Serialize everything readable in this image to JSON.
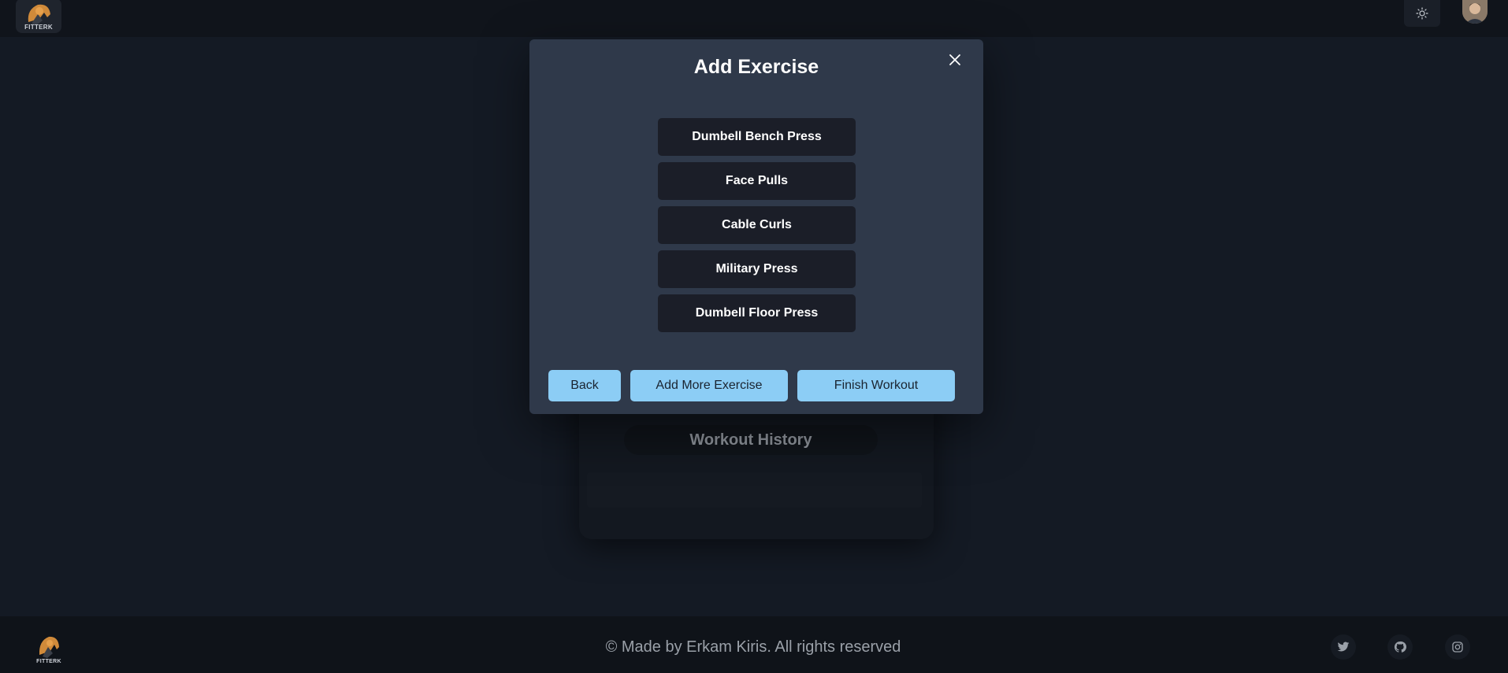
{
  "header": {
    "logo_text": "FITTERK",
    "theme_icon": "sun-icon"
  },
  "background": {
    "history_label": "Workout History"
  },
  "modal": {
    "title": "Add Exercise",
    "close_icon": "close-icon",
    "exercises": [
      "Dumbell Bench Press",
      "Face Pulls",
      "Cable Curls",
      "Military Press",
      "Dumbell Floor Press"
    ],
    "back_label": "Back",
    "add_more_label": "Add More Exercise",
    "finish_label": "Finish Workout"
  },
  "footer": {
    "logo_text": "FITTERK",
    "copyright": "© Made by Erkam Kiris. All rights reserved",
    "social_icons": [
      "twitter-icon",
      "github-icon",
      "instagram-icon"
    ]
  },
  "colors": {
    "accent": "#8ccdf5",
    "modal_bg": "#2f394a",
    "exercise_bg": "#1b1e28",
    "page_bg": "#141a24"
  }
}
